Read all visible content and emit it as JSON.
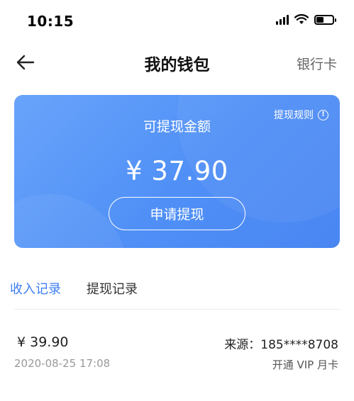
{
  "status_bar": {
    "time": "10:15"
  },
  "nav": {
    "title": "我的钱包",
    "right_label": "银行卡"
  },
  "card": {
    "rules_label": "提现规则",
    "info_glyph": "!",
    "balance_label": "可提现金额",
    "balance_value": "¥ 37.90",
    "withdraw_button": "申请提现"
  },
  "tabs": [
    {
      "label": "收入记录",
      "active": true
    },
    {
      "label": "提现记录",
      "active": false
    }
  ],
  "records": [
    {
      "amount": "¥ 39.90",
      "date": "2020-08-25 17:08",
      "source": "来源：185****8708",
      "description": "开通 VIP 月卡"
    }
  ],
  "colors": {
    "accent": "#3d7ef2",
    "card_gradient_start": "#69a4fb",
    "card_gradient_end": "#4a86f2"
  }
}
